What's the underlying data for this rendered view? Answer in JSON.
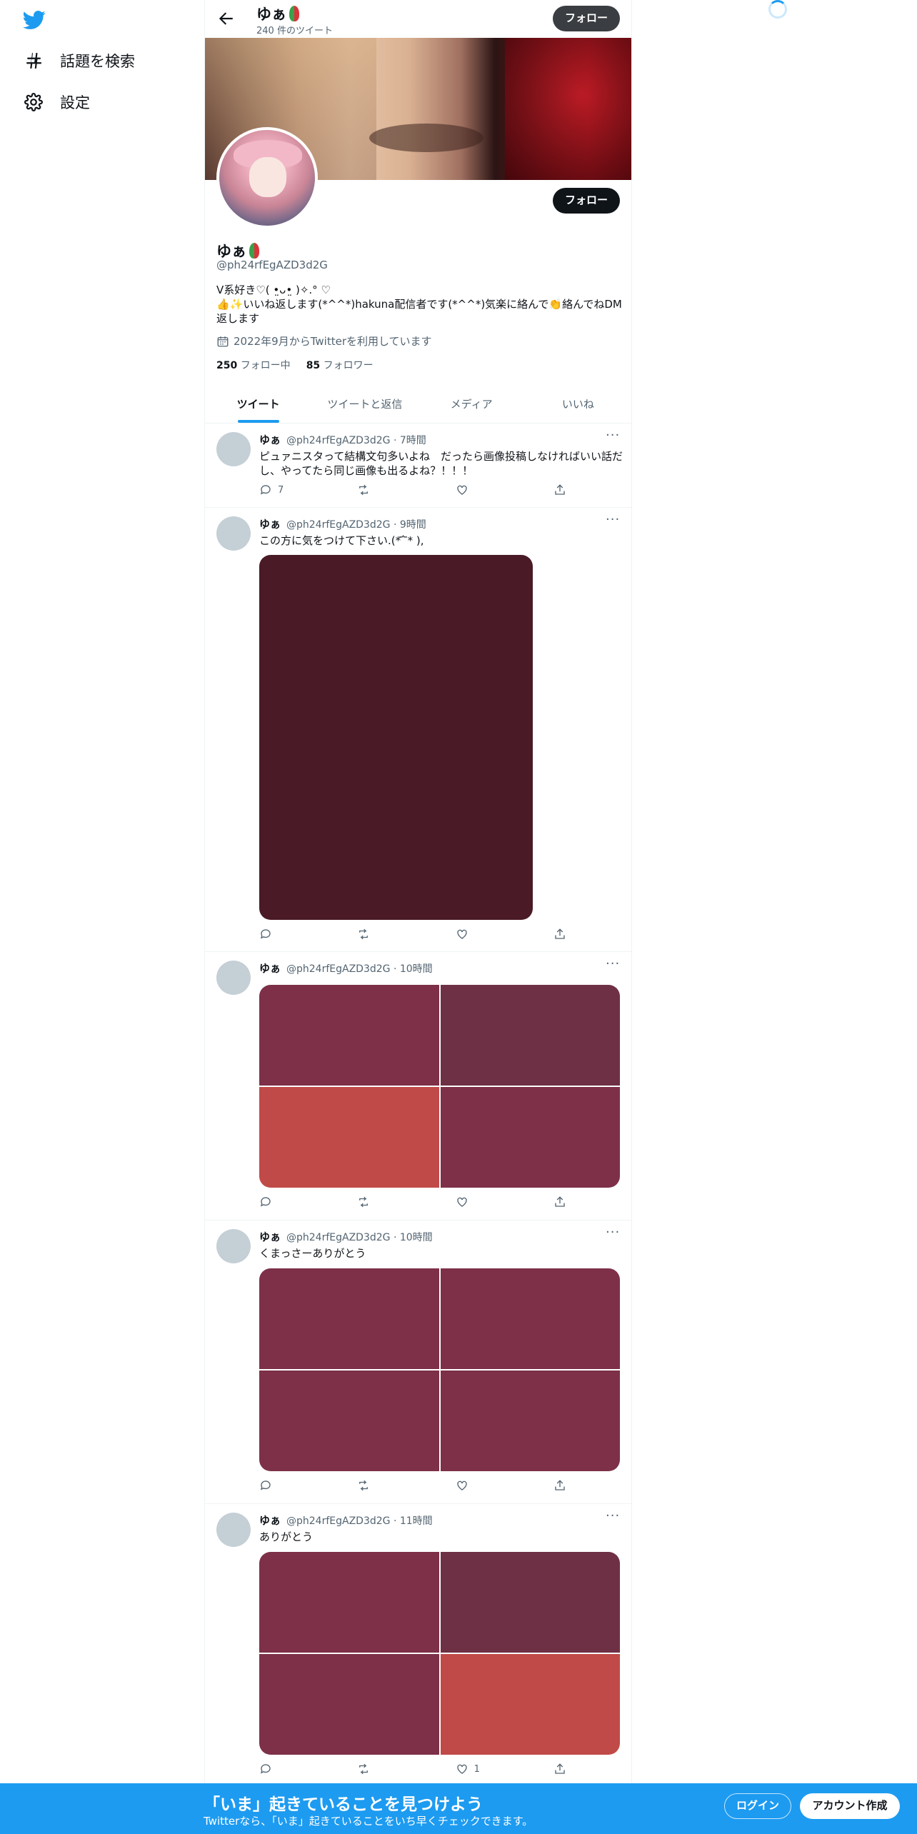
{
  "nav": {
    "logo": "twitter-bird-icon",
    "items": [
      {
        "label": "話題を検索",
        "icon": "hash-icon"
      },
      {
        "label": "設定",
        "icon": "gear-icon"
      }
    ]
  },
  "header": {
    "name": "ゆぁ",
    "tweet_count": "240 件のツイート",
    "follow_label": "フォロー"
  },
  "profile": {
    "name": "ゆぁ",
    "handle": "@ph24rfEgAZD3d2G",
    "follow_label": "フォロー",
    "bio": "V系好き♡( •̤ᴗ•̤ )✧.° ♡\n👍✨いいね返します(*^^*)hakuna配信者です(*^^*)気楽に絡んで👏絡んでねDM返します",
    "joined": "2022年9月からTwitterを利用しています",
    "following_count": "250",
    "following_label": "フォロー中",
    "followers_count": "85",
    "followers_label": "フォロワー"
  },
  "tabs": [
    "ツイート",
    "ツイートと返信",
    "メディア",
    "いいね"
  ],
  "tweets": [
    {
      "name": "ゆぁ",
      "meta": "@ph24rfEgAZD3d2G · 7時間",
      "text": "ピュァニスタって結構文句多いよね　だったら画像投稿しなければいい話だし、やってたら同じ画像も出るよね？！！！",
      "replies": "7",
      "retweets": "",
      "likes": ""
    },
    {
      "name": "ゆぁ",
      "meta": "@ph24rfEgAZD3d2G · 9時間",
      "text": "この方に気をつけて下さい.(* ᷄ ᷅* ),",
      "replies": "",
      "retweets": "",
      "likes": ""
    },
    {
      "name": "ゆぁ",
      "meta": "@ph24rfEgAZD3d2G · 10時間",
      "text": "",
      "replies": "",
      "retweets": "",
      "likes": ""
    },
    {
      "name": "ゆぁ",
      "meta": "@ph24rfEgAZD3d2G · 10時間",
      "text": "くまっさーありがとう",
      "replies": "",
      "retweets": "",
      "likes": ""
    },
    {
      "name": "ゆぁ",
      "meta": "@ph24rfEgAZD3d2G · 11時間",
      "text": "ありがとう",
      "replies": "",
      "retweets": "",
      "likes": "1"
    }
  ],
  "media_colors": {
    "single": "#4a1a26",
    "grid_a": [
      "#7d3048",
      "#6e3044",
      "#c04a48",
      "#7d3048"
    ],
    "grid_b": [
      "#7d3048",
      "#7d3048",
      "#7d3048",
      "#7d3048"
    ],
    "grid_c": [
      "#7d3048",
      "#6e3044",
      "#7d3048",
      "#c04a48"
    ]
  },
  "bottom": {
    "title": "「いま」起きていることを見つけよう",
    "subtitle": "Twitterなら、「いま」起きていることをいち早くチェックできます。",
    "login": "ログイン",
    "signup": "アカウント作成"
  },
  "colors": {
    "accent": "#1d9bf0",
    "text": "#0f1419",
    "muted": "#536471"
  }
}
